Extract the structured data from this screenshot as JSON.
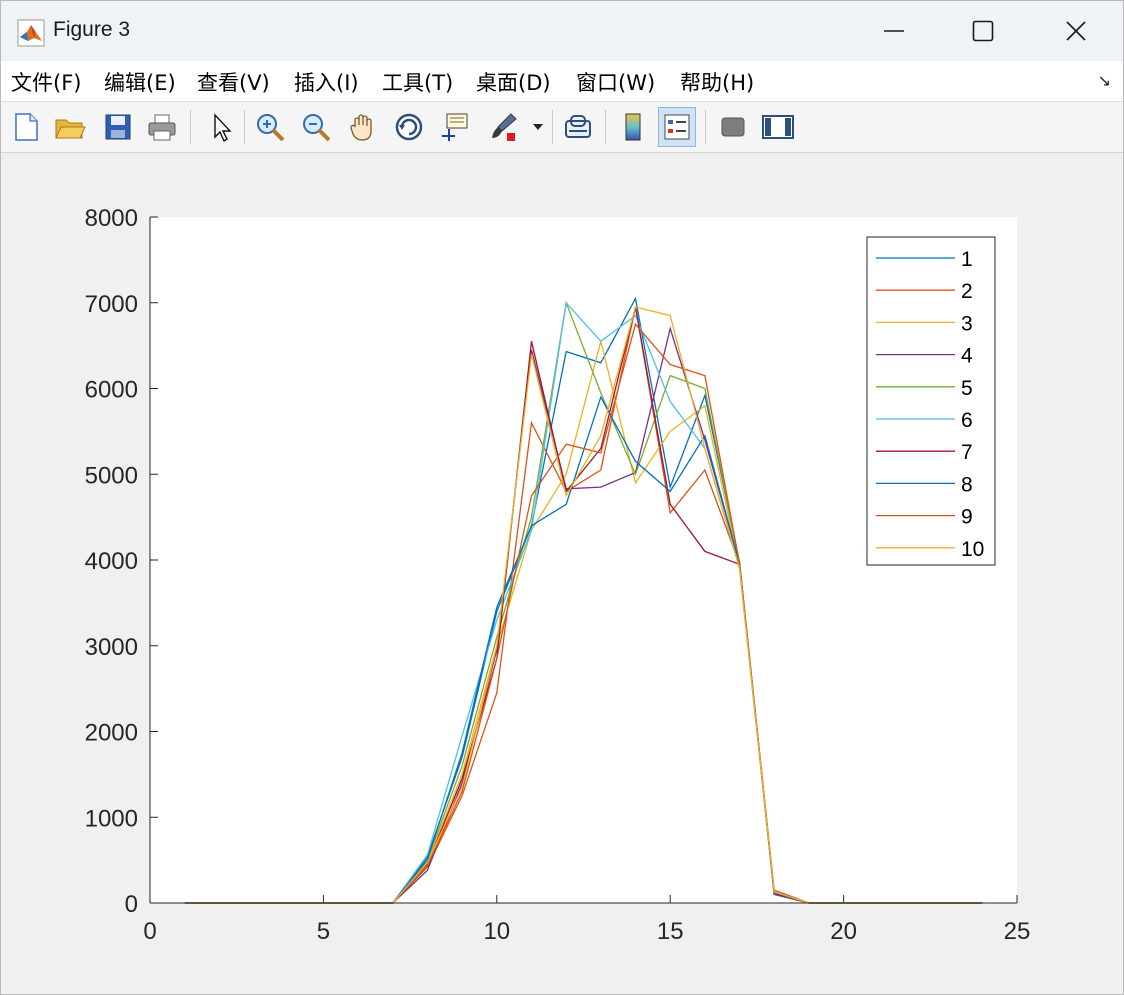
{
  "window": {
    "title": "Figure 3"
  },
  "menu": [
    {
      "label": "文件(F)"
    },
    {
      "label": "编辑(E)"
    },
    {
      "label": "查看(V)"
    },
    {
      "label": "插入(I)"
    },
    {
      "label": "工具(T)"
    },
    {
      "label": "桌面(D)"
    },
    {
      "label": "窗口(W)"
    },
    {
      "label": "帮助(H)"
    }
  ],
  "toolbar": {
    "icons": [
      "new-figure-icon",
      "open-icon",
      "save-icon",
      "print-icon",
      "edit-plot-icon",
      "zoom-in-icon",
      "zoom-out-icon",
      "pan-icon",
      "rotate-3d-icon",
      "data-cursor-icon",
      "brush-icon",
      "link-plot-icon",
      "colorbar-icon",
      "legend-icon",
      "hide-plot-tools-icon",
      "show-plot-tools-icon"
    ]
  },
  "colors": {
    "series": [
      "#0072BD",
      "#D95319",
      "#EDB120",
      "#7E2F8E",
      "#77AC30",
      "#4DBEEE",
      "#A2142F",
      "#0072BD",
      "#D95319",
      "#EDB120"
    ]
  },
  "chart_data": {
    "type": "line",
    "title": "",
    "xlabel": "",
    "ylabel": "",
    "xlim": [
      0,
      25
    ],
    "ylim": [
      0,
      8000
    ],
    "xticks": [
      0,
      5,
      10,
      15,
      20,
      25
    ],
    "yticks": [
      0,
      1000,
      2000,
      3000,
      4000,
      5000,
      6000,
      7000,
      8000
    ],
    "legend_position": "top-right",
    "grid": false,
    "x": [
      1,
      2,
      3,
      4,
      5,
      6,
      7,
      8,
      9,
      10,
      11,
      12,
      13,
      14,
      15,
      16,
      17,
      18,
      19,
      20,
      21,
      22,
      23,
      24
    ],
    "series": [
      {
        "name": "1",
        "values": [
          0,
          0,
          0,
          0,
          0,
          0,
          0,
          540,
          1700,
          3400,
          4400,
          6430,
          6300,
          7050,
          4850,
          5920,
          3970,
          120,
          0,
          0,
          0,
          0,
          0,
          0
        ]
      },
      {
        "name": "2",
        "values": [
          0,
          0,
          0,
          0,
          0,
          0,
          0,
          420,
          1250,
          2450,
          5600,
          4800,
          5050,
          6950,
          4550,
          5050,
          3950,
          100,
          0,
          0,
          0,
          0,
          0,
          0
        ]
      },
      {
        "name": "3",
        "values": [
          0,
          0,
          0,
          0,
          0,
          0,
          0,
          480,
          1500,
          3000,
          4350,
          5000,
          6550,
          4900,
          5500,
          5800,
          3900,
          110,
          0,
          0,
          0,
          0,
          0,
          0
        ]
      },
      {
        "name": "4",
        "values": [
          0,
          0,
          0,
          0,
          0,
          0,
          0,
          380,
          1400,
          2950,
          6450,
          4830,
          4850,
          5020,
          6700,
          5400,
          3950,
          100,
          0,
          0,
          0,
          0,
          0,
          0
        ]
      },
      {
        "name": "5",
        "values": [
          0,
          0,
          0,
          0,
          0,
          0,
          0,
          500,
          1600,
          3100,
          4500,
          7000,
          5950,
          5000,
          6150,
          6000,
          3950,
          120,
          0,
          0,
          0,
          0,
          0,
          0
        ]
      },
      {
        "name": "6",
        "values": [
          0,
          0,
          0,
          0,
          0,
          0,
          0,
          560,
          1950,
          3300,
          4350,
          7000,
          6550,
          6850,
          5850,
          5300,
          3900,
          110,
          0,
          0,
          0,
          0,
          0,
          0
        ]
      },
      {
        "name": "7",
        "values": [
          0,
          0,
          0,
          0,
          0,
          0,
          0,
          450,
          1450,
          2850,
          6550,
          4800,
          5300,
          6950,
          4650,
          4100,
          3950,
          110,
          0,
          0,
          0,
          0,
          0,
          0
        ]
      },
      {
        "name": "8",
        "values": [
          0,
          0,
          0,
          0,
          0,
          0,
          0,
          510,
          1750,
          3450,
          4400,
          4650,
          5900,
          5150,
          4800,
          5450,
          3950,
          120,
          0,
          0,
          0,
          0,
          0,
          0
        ]
      },
      {
        "name": "9",
        "values": [
          0,
          0,
          0,
          0,
          0,
          0,
          0,
          440,
          1300,
          2850,
          4750,
          5350,
          5250,
          6750,
          6280,
          6150,
          3950,
          150,
          0,
          0,
          0,
          0,
          0,
          0
        ]
      },
      {
        "name": "10",
        "values": [
          0,
          0,
          0,
          0,
          0,
          0,
          0,
          470,
          1350,
          3000,
          6400,
          4750,
          5450,
          6950,
          6850,
          5300,
          3900,
          130,
          0,
          0,
          0,
          0,
          0,
          0
        ]
      }
    ]
  }
}
